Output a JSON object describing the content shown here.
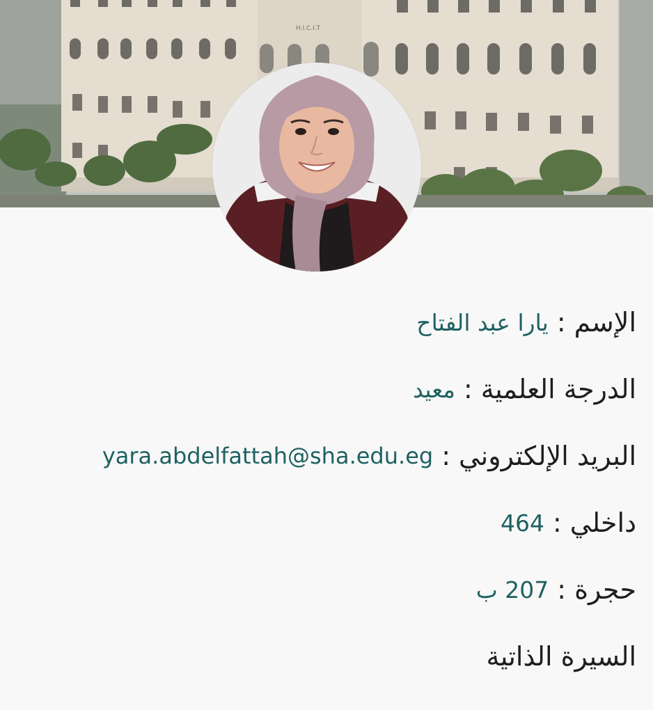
{
  "banner": {
    "building_sign": "H.I.C.I.T"
  },
  "profile": {
    "photo_alt": "profile-photo"
  },
  "fields": {
    "name": {
      "label": "الإسم",
      "separator": ":",
      "value": "يارا عبد الفتاح"
    },
    "degree": {
      "label": "الدرجة العلمية",
      "separator": ":",
      "value": "معيد"
    },
    "email": {
      "label": "البريد الإلكتروني",
      "separator": ":",
      "value": "yara.abdelfattah@sha.edu.eg"
    },
    "extension": {
      "label": "داخلي",
      "separator": ":",
      "value": "464"
    },
    "room": {
      "label": "حجرة",
      "separator": ":",
      "value": "207 ب"
    },
    "cv": {
      "label": "السيرة الذاتية"
    }
  },
  "colors": {
    "value_text": "#1f6161",
    "label_text": "#1e1e1e",
    "background": "#f8f8f8"
  }
}
